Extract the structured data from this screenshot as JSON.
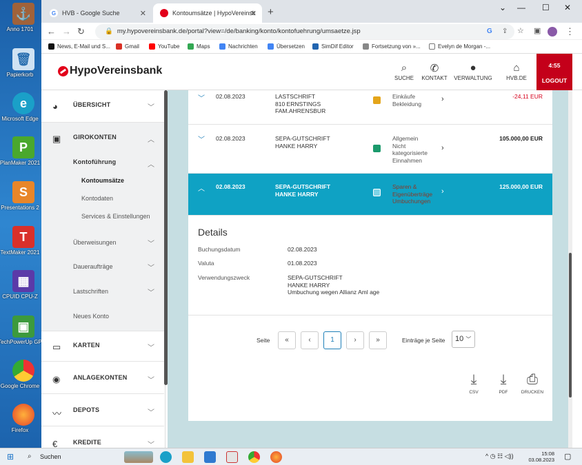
{
  "desktop": {
    "icons": [
      "Anno 1701",
      "Papierkorb",
      "Microsoft Edge",
      "PlanMaker 2021",
      "Presentations 2",
      "TextMaker 2021",
      "CPUID CPU-Z",
      "TechPowerUp GP",
      "Google Chrome",
      "Firefox"
    ]
  },
  "browser": {
    "tabs": [
      {
        "title": "HVB - Google Suche",
        "close": "✕"
      },
      {
        "title": "Kontoumsätze | HypoVereinsbank",
        "close": "✕"
      }
    ],
    "new_tab": "+",
    "url": "my.hypovereinsbank.de/portal?view=/de/banking/konto/kontofuehrung/umsaetze.jsp",
    "bookmarks": [
      "News, E-Mail und S...",
      "Gmail",
      "YouTube",
      "Maps",
      "Nachrichten",
      "Übersetzen",
      "SimDif Editor",
      "Fortsetzung von »...",
      "Evelyn de Morgan -..."
    ]
  },
  "header": {
    "logo": "HypoVereinsbank",
    "nav": [
      {
        "label": "SUCHE",
        "icon": "search-icon"
      },
      {
        "label": "KONTAKT",
        "icon": "phone-icon"
      },
      {
        "label": "VERWALTUNG",
        "icon": "user-icon"
      },
      {
        "label": "HVB.DE",
        "icon": "home-icon"
      }
    ],
    "timer": "4:55",
    "logout": "LOGOUT"
  },
  "sidebar": {
    "sections": [
      {
        "label": "ÜBERSICHT"
      },
      {
        "label": "GIROKONTEN"
      },
      {
        "label": "KARTEN"
      },
      {
        "label": "ANLAGEKONTEN"
      },
      {
        "label": "DEPOTS"
      },
      {
        "label": "KREDITE"
      }
    ],
    "kontofuehrung": "Kontoführung",
    "sub": [
      "Kontoumsätze",
      "Kontodaten",
      "Services & Einstellungen"
    ],
    "more": [
      "Überweisungen",
      "Daueraufträge",
      "Lastschriften",
      "Neues Konto"
    ]
  },
  "transactions": [
    {
      "date": "02.08.2023",
      "desc": [
        "LASTSCHRIFT",
        "810 ERNSTINGS",
        "FAM.AHRENSBUR"
      ],
      "category": [
        "Einkäufe",
        "Bekleidung"
      ],
      "amount": "-24,11 EUR",
      "color": "#e4a51a",
      "amount_color": "#d6001c"
    },
    {
      "date": "02.08.2023",
      "desc": [
        "SEPA-GUTSCHRIFT",
        "HANKE HARRY"
      ],
      "category": [
        "Allgemein",
        "Nicht",
        "kategorisierte",
        "Einnahmen"
      ],
      "amount": "105.000,00 EUR",
      "color": "#1b9a6c",
      "amount_color": "#222222"
    },
    {
      "date": "02.08.2023",
      "desc": [
        "SEPA-GUTSCHRIFT",
        "HANKE HARRY"
      ],
      "category": [
        "Sparen &",
        "Eigenüberträge",
        "Umbuchungen"
      ],
      "amount": "125.000,00 EUR",
      "color": "#7fd3e6",
      "amount_color": "#ffffff"
    }
  ],
  "details": {
    "title": "Details",
    "rows": [
      {
        "label": "Buchungsdatum",
        "value": [
          "02.08.2023"
        ]
      },
      {
        "label": "Valuta",
        "value": [
          "01.08.2023"
        ]
      },
      {
        "label": "Verwendungszweck",
        "value": [
          "SEPA-GUTSCHRIFT",
          "HANKE HARRY",
          "Umbuchung wegen Allianz Aml age"
        ]
      }
    ]
  },
  "pager": {
    "label": "Seite",
    "first": "«",
    "prev": "‹",
    "current": "1",
    "next": "›",
    "last": "»",
    "per_page_label": "Einträge je Seite",
    "per_page": "10"
  },
  "downloads": [
    {
      "label": "CSV"
    },
    {
      "label": "PDF"
    },
    {
      "label": "DRUCKEN"
    }
  ],
  "taskbar": {
    "search": "Suchen",
    "time": "15:08",
    "date": "03.08.2023"
  }
}
